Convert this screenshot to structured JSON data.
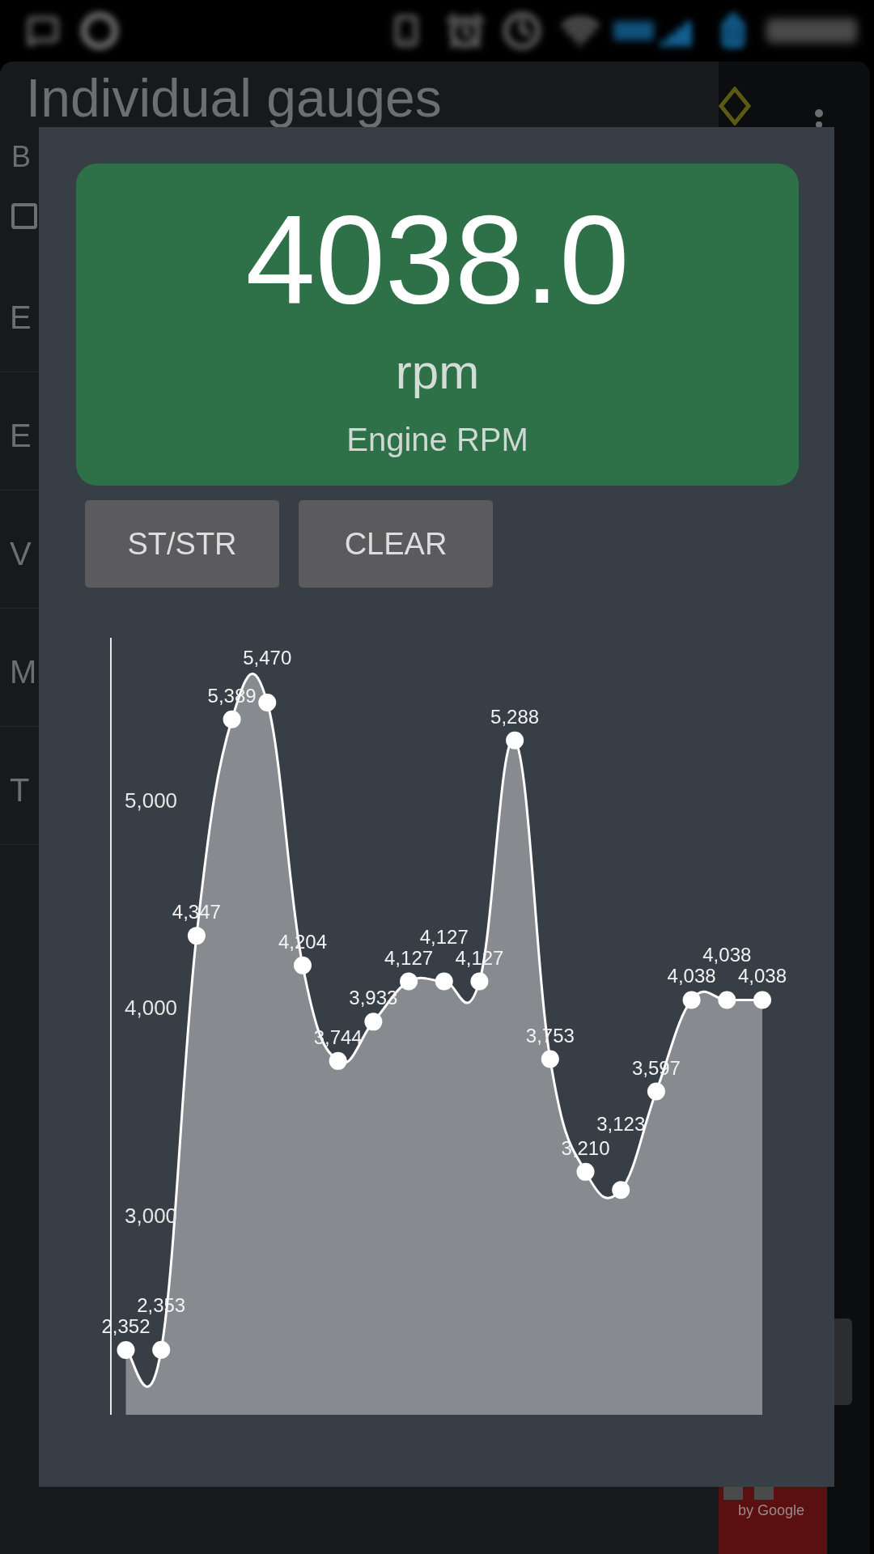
{
  "background_screen": {
    "title": "Individual gauges",
    "subtitle": "B",
    "checkbox": {
      "checked": false
    },
    "list_items": [
      "E",
      "E",
      "V",
      "M",
      "T"
    ],
    "ad": {
      "text": "by Google"
    }
  },
  "dialog": {
    "gauge": {
      "value": "4038.0",
      "unit": "rpm",
      "label": "Engine RPM"
    },
    "buttons": [
      "ST/STR",
      "CLEAR"
    ],
    "chart_data": {
      "type": "area",
      "categories": [
        null,
        null,
        null,
        null,
        null,
        null,
        null,
        null,
        null,
        null,
        null,
        null,
        null,
        null,
        null,
        null,
        null,
        null,
        null
      ],
      "series": [
        {
          "color": "#878b8f",
          "values": [
            2352,
            2353,
            4347,
            5389,
            5470,
            4204,
            3744,
            3933,
            4127,
            4127,
            4127,
            5288,
            3753,
            3210,
            3123,
            3597,
            4038,
            4038,
            4038
          ]
        }
      ],
      "ylim": [
        2040.2,
        5781.8
      ],
      "yticks": [
        {
          "value": 3000,
          "label": "3,000"
        },
        {
          "value": 4000,
          "label": "4,000"
        },
        {
          "value": 5000,
          "label": "5,000"
        }
      ],
      "value_labels": [
        "2,352",
        "2,353",
        "4,347",
        "5,389",
        "5,470",
        "4,204",
        "3,744",
        "3,933",
        "4,127",
        "4,127",
        "4,127",
        "5,288",
        "3,753",
        "3,210",
        "3,123",
        "3,597",
        "4,038",
        "4,038",
        "4,038"
      ]
    }
  }
}
